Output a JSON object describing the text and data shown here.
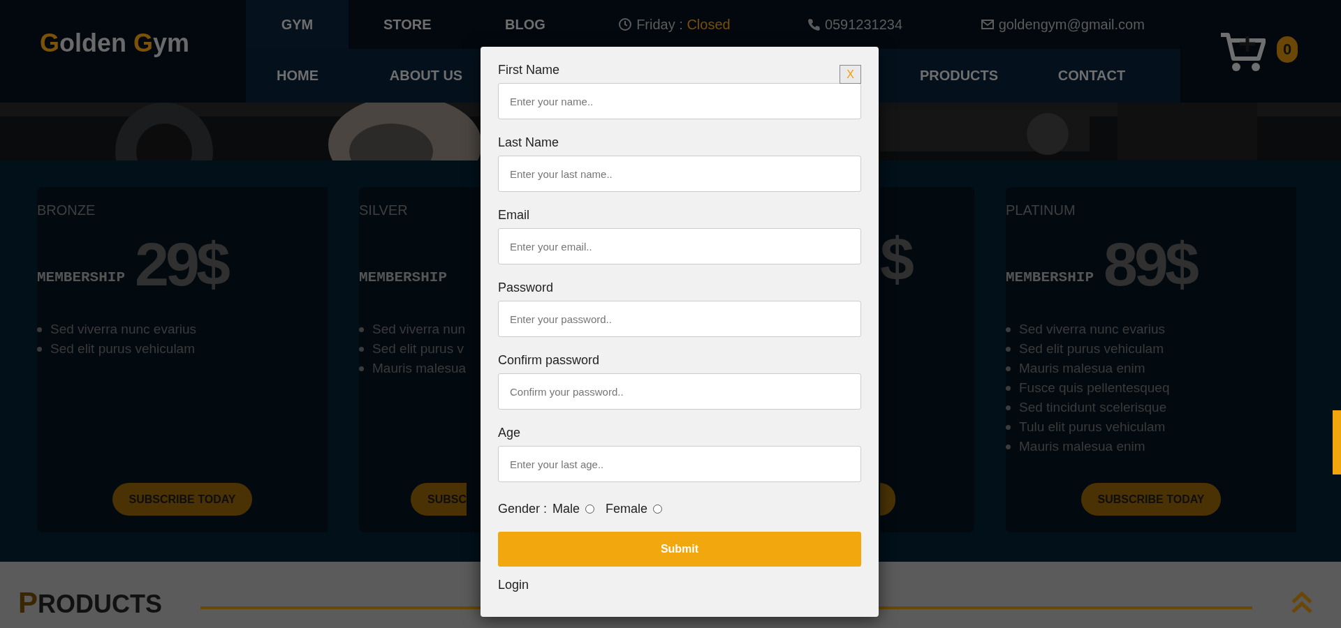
{
  "brand": "Golden Gym",
  "top_nav": [
    {
      "label": "GYM",
      "selected": true
    },
    {
      "label": "STORE",
      "selected": false
    },
    {
      "label": "BLOG",
      "selected": false
    }
  ],
  "contacts": [
    {
      "kind": "hours",
      "label": "Friday : ",
      "status": "Closed"
    },
    {
      "kind": "phone",
      "label": "0591231234"
    },
    {
      "kind": "email",
      "label": "goldengym@gmail.com"
    }
  ],
  "main_nav": [
    {
      "label": "HOME"
    },
    {
      "label": "ABOUT US"
    },
    {
      "label": "PRODUCTS"
    },
    {
      "label": "CONTACT"
    }
  ],
  "cart": {
    "count": "0"
  },
  "plans": [
    {
      "kind": "full",
      "name": "BRONZE",
      "tagline": "MEMBERSHIP",
      "price": "29$",
      "features": [
        "Sed viverra nunc evarius",
        "Sed elit purus vehiculam"
      ],
      "button": "SUBSCRIBE TODAY"
    },
    {
      "kind": "left",
      "name": "SILVER",
      "tagline": "MEMBERSHIP",
      "features": [
        "Sed viverra nun",
        "Sed elit purus v",
        "Mauris malesua"
      ],
      "button": "SUBSC"
    },
    {
      "kind": "right",
      "price": "$"
    },
    {
      "kind": "full",
      "name": "PLATINUM",
      "tagline": "MEMBERSHIP",
      "price": "89$",
      "features": [
        "Sed viverra nunc evarius",
        "Sed elit purus vehiculam",
        "Mauris malesua enim",
        "Fusce quis pellentesqueq",
        "Sed tincidunt scelerisque",
        "Tulu elit purus vehiculam",
        "Mauris malesua enim"
      ],
      "button": "SUBSCRIBE TODAY"
    }
  ],
  "signup_form": {
    "close": "X",
    "fields": [
      {
        "label": "First Name",
        "placeholder": "Enter your name.."
      },
      {
        "label": "Last Name",
        "placeholder": "Enter your last name.."
      },
      {
        "label": "Email",
        "placeholder": "Enter your email.."
      },
      {
        "label": "Password",
        "placeholder": "Enter your password.."
      },
      {
        "label": "Confirm password",
        "placeholder": "Confirm your password.."
      },
      {
        "label": "Age",
        "placeholder": "Enter your last age.."
      }
    ],
    "gender": {
      "label": "Gender :",
      "options": [
        {
          "label": "Male",
          "checked": false
        },
        {
          "label": "Female",
          "checked": false
        }
      ]
    },
    "submit": "Submit",
    "login": "Login"
  },
  "products_section": {
    "title": "PRODUCTS"
  }
}
